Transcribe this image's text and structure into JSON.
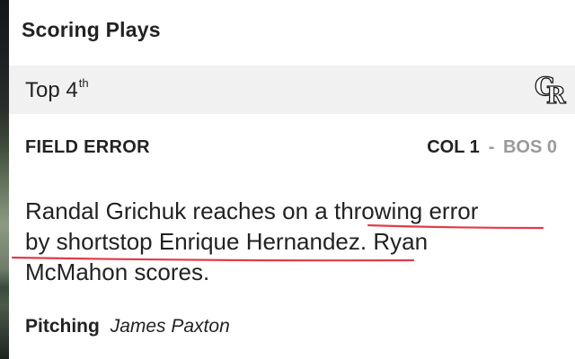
{
  "section": {
    "title": "Scoring Plays"
  },
  "inning": {
    "label": "Top 4",
    "suffix": "th"
  },
  "team_logo": {
    "icon": "rockies-cr-logo-icon",
    "text": "CR"
  },
  "play": {
    "type": "FIELD ERROR",
    "score": {
      "home_team": "COL",
      "home_score": "1",
      "separator": "-",
      "away_team": "BOS",
      "away_score": "0"
    },
    "description_lines": [
      "Randal Grichuk reaches on a throwing error",
      "by shortstop Enrique Hernandez.   Ryan",
      "McMahon scores."
    ]
  },
  "pitching": {
    "label": "Pitching",
    "name": "James Paxton"
  },
  "colors": {
    "annotation": "#e23b4a",
    "inning_bar": "#f1f1f1",
    "muted": "#9a9a9a"
  }
}
